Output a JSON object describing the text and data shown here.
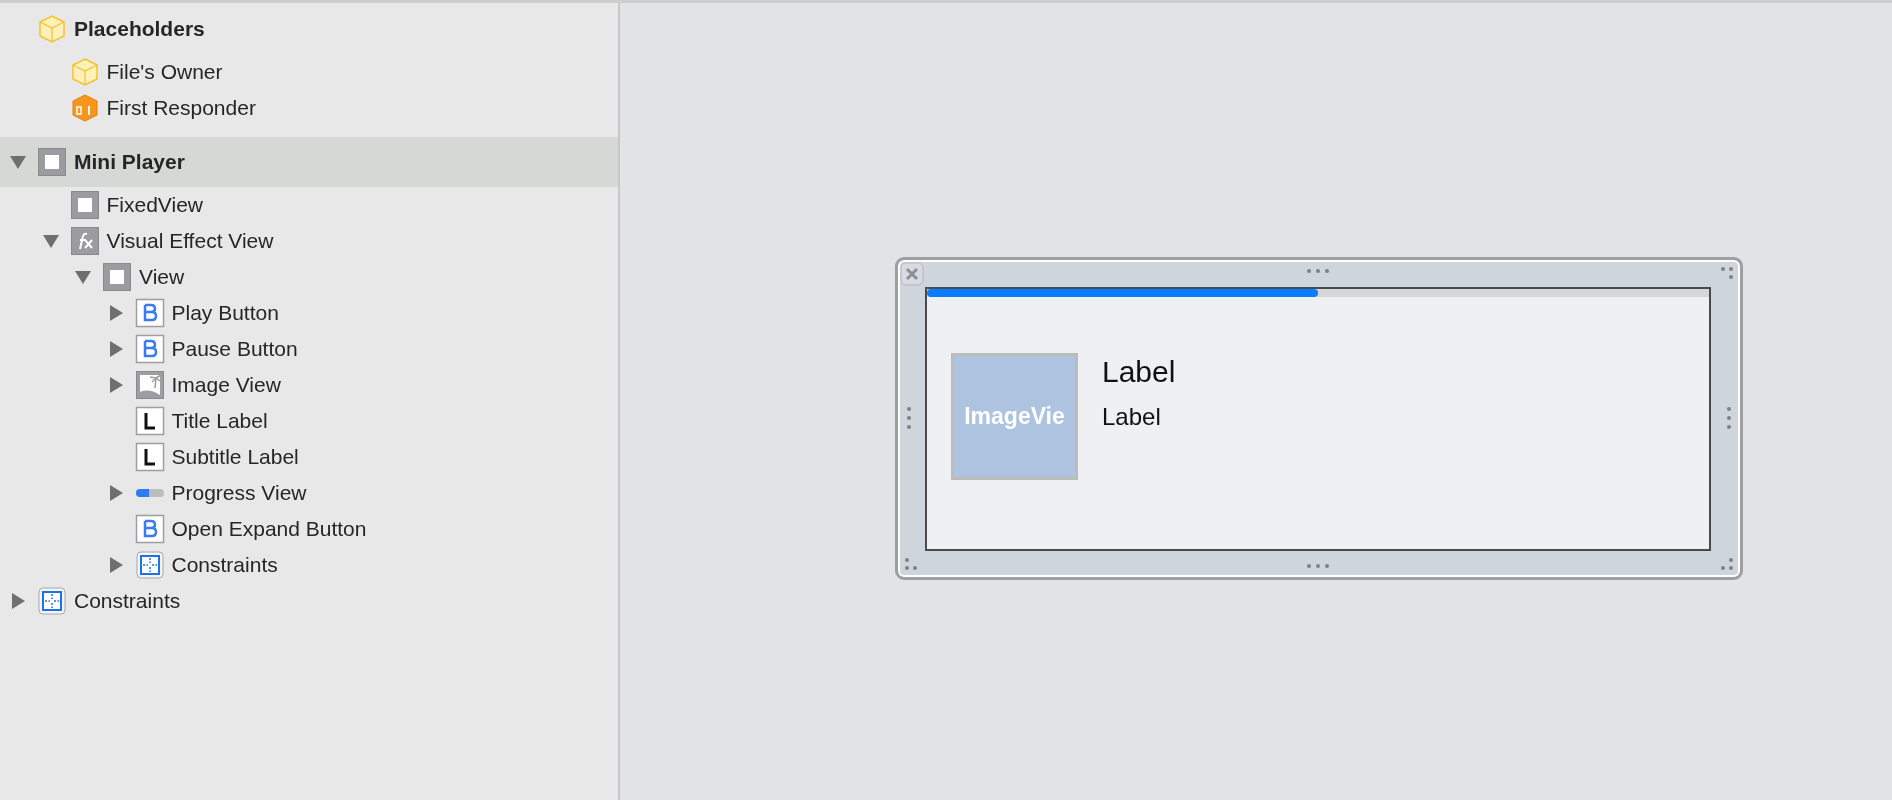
{
  "outline": [
    {
      "label": "Placeholders",
      "kind": "placeholder",
      "bold": true,
      "selected": false,
      "children": [
        {
          "label": "File's Owner",
          "kind": "placeholder",
          "selected": false
        },
        {
          "label": "First Responder",
          "kind": "responder",
          "selected": false
        }
      ]
    },
    {
      "label": "Mini Player",
      "kind": "view",
      "bold": true,
      "selected": true,
      "expanded": true,
      "children": [
        {
          "label": "FixedView",
          "kind": "view",
          "selected": false
        },
        {
          "label": "Visual Effect View",
          "kind": "effect",
          "selected": false,
          "expanded": true,
          "children": [
            {
              "label": "View",
              "kind": "view",
              "selected": false,
              "expanded": true,
              "children": [
                {
                  "label": "Play Button",
                  "kind": "button",
                  "selected": false,
                  "expanded": false
                },
                {
                  "label": "Pause Button",
                  "kind": "button",
                  "selected": false,
                  "expanded": false
                },
                {
                  "label": "Image View",
                  "kind": "image",
                  "selected": false,
                  "expanded": false
                },
                {
                  "label": "Title Label",
                  "kind": "label",
                  "selected": false
                },
                {
                  "label": "Subtitle Label",
                  "kind": "label",
                  "selected": false
                },
                {
                  "label": "Progress View",
                  "kind": "progress",
                  "selected": false,
                  "expanded": false
                },
                {
                  "label": "Open Expand Button",
                  "kind": "button",
                  "selected": false
                },
                {
                  "label": "Constraints",
                  "kind": "constraints",
                  "selected": false,
                  "expanded": false
                }
              ]
            }
          ]
        }
      ]
    },
    {
      "label": "Constraints",
      "kind": "constraints",
      "bold": false,
      "selected": false,
      "expanded": false
    }
  ],
  "canvas": {
    "progress": {
      "level": 0.5
    },
    "image_view": {
      "text": "ImageVie"
    },
    "title_label": "Label",
    "subtitle_label": "Label"
  }
}
